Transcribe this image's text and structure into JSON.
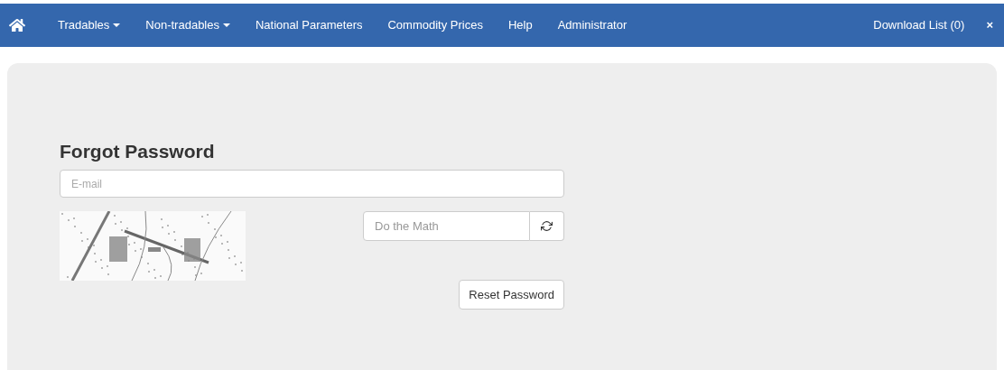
{
  "navbar": {
    "items": [
      {
        "label": "Tradables",
        "kind": "dropdown"
      },
      {
        "label": "Non-tradables",
        "kind": "dropdown"
      },
      {
        "label": "National Parameters",
        "kind": "link"
      },
      {
        "label": "Commodity Prices",
        "kind": "link"
      },
      {
        "label": "Help",
        "kind": "link"
      },
      {
        "label": "Administrator",
        "kind": "link"
      }
    ],
    "right": {
      "download_list": "Download List (0)",
      "close": "×"
    }
  },
  "form": {
    "title": "Forgot Password",
    "email": {
      "placeholder": "E-mail"
    },
    "answer": {
      "placeholder": "Do the Math"
    },
    "submit": "Reset Password"
  }
}
